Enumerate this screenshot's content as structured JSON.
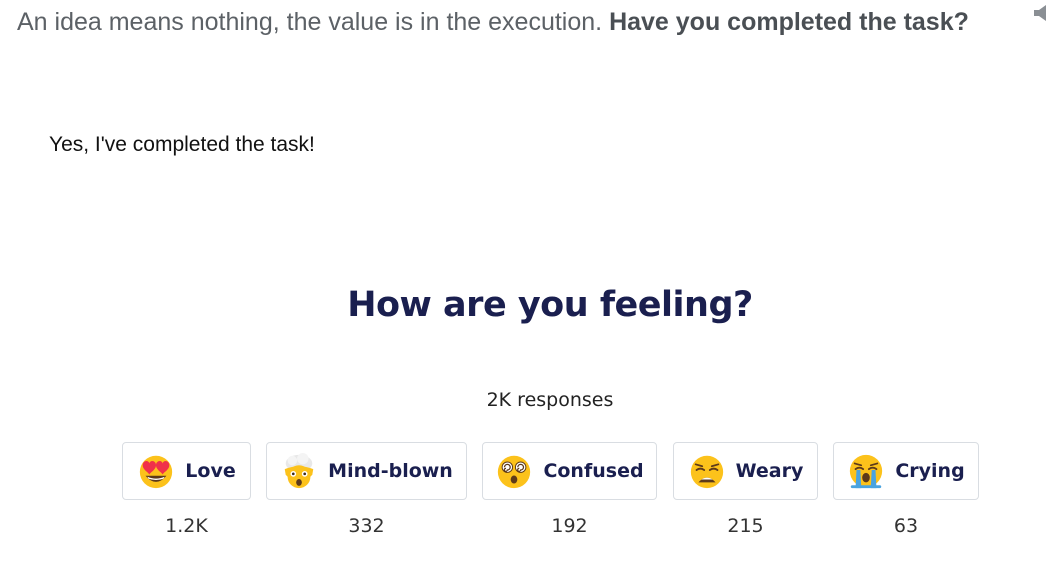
{
  "intro": {
    "text": "An idea means nothing, the value is in the execution. ",
    "question": "Have you completed the task?"
  },
  "answer": "Yes, I've completed the task!",
  "feedback": {
    "heading": "How are you feeling?",
    "responses": "2K responses",
    "reactions": [
      {
        "label": "Love",
        "count": "1.2K",
        "icon": "heart-eyes-icon"
      },
      {
        "label": "Mind-blown",
        "count": "332",
        "icon": "exploding-head-icon"
      },
      {
        "label": "Confused",
        "count": "192",
        "icon": "dizzy-face-icon"
      },
      {
        "label": "Weary",
        "count": "215",
        "icon": "weary-face-icon"
      },
      {
        "label": "Crying",
        "count": "63",
        "icon": "crying-face-icon"
      }
    ]
  },
  "colors": {
    "heading": "#1a1f4f",
    "emoji_yellow": "#fcc21b",
    "heart_red": "#f0314a",
    "tear_blue": "#4aa3df"
  }
}
